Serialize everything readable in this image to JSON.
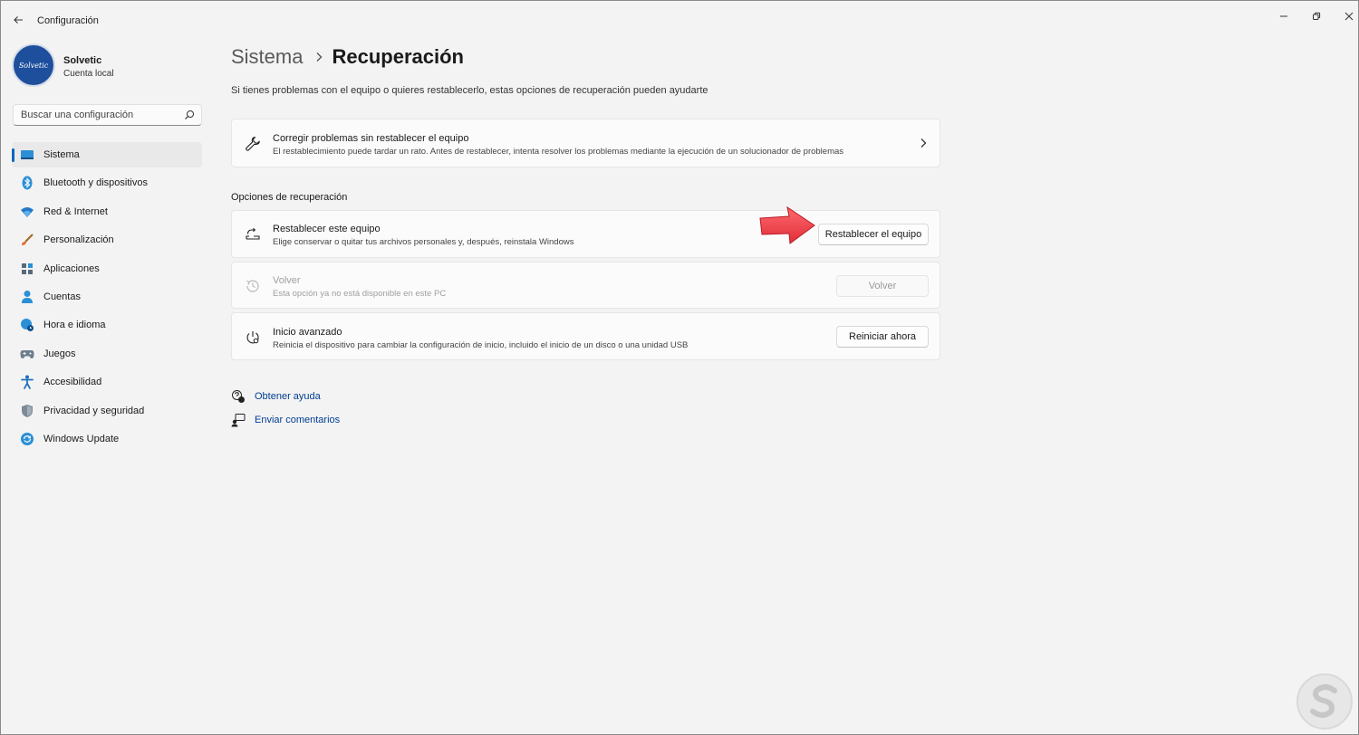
{
  "window": {
    "title": "Configuración",
    "controls": [
      "minimize-icon",
      "maximize-icon",
      "close-icon"
    ]
  },
  "profile": {
    "avatar_text": "Solvetic",
    "name": "Solvetic",
    "account_type": "Cuenta local"
  },
  "search": {
    "placeholder": "Buscar una configuración",
    "icon": "search-icon"
  },
  "sidebar": {
    "items": [
      {
        "label": "Sistema",
        "icon": "system-icon",
        "active": true
      },
      {
        "label": "Bluetooth y dispositivos",
        "icon": "bluetooth-icon"
      },
      {
        "label": "Red & Internet",
        "icon": "wifi-icon"
      },
      {
        "label": "Personalización",
        "icon": "brush-icon"
      },
      {
        "label": "Aplicaciones",
        "icon": "apps-icon"
      },
      {
        "label": "Cuentas",
        "icon": "person-icon"
      },
      {
        "label": "Hora e idioma",
        "icon": "globe-clock-icon"
      },
      {
        "label": "Juegos",
        "icon": "gamepad-icon"
      },
      {
        "label": "Accesibilidad",
        "icon": "accessibility-icon"
      },
      {
        "label": "Privacidad y seguridad",
        "icon": "shield-icon"
      },
      {
        "label": "Windows Update",
        "icon": "update-icon"
      }
    ]
  },
  "breadcrumb": {
    "parent": "Sistema",
    "current": "Recuperación"
  },
  "main": {
    "subtitle": "Si tienes problemas con el equipo o quieres restablecerlo, estas opciones de recuperación pueden ayudarte",
    "troubleshoot": {
      "title": "Corregir problemas sin restablecer el equipo",
      "description": "El restablecimiento puede tardar un rato. Antes de restablecer, intenta resolver los problemas mediante la ejecución de un solucionador de problemas",
      "icon": "wrench-icon"
    },
    "section_label": "Opciones de recuperación",
    "options": [
      {
        "title": "Restablecer este equipo",
        "description": "Elige conservar o quitar tus archivos personales y, después, reinstala Windows",
        "button": "Restablecer el equipo",
        "icon": "reset-pc-icon",
        "enabled": true
      },
      {
        "title": "Volver",
        "description": "Esta opción ya no está disponible en este PC",
        "button": "Volver",
        "icon": "history-icon",
        "enabled": false
      },
      {
        "title": "Inicio avanzado",
        "description": "Reinicia el dispositivo para cambiar la configuración de inicio, incluido el inicio de un disco o una unidad USB",
        "button": "Reiniciar ahora",
        "icon": "advanced-startup-icon",
        "enabled": true
      }
    ],
    "links": [
      {
        "label": "Obtener ayuda",
        "icon": "help-chat-icon"
      },
      {
        "label": "Enviar comentarios",
        "icon": "feedback-icon"
      }
    ]
  },
  "colors": {
    "accent": "#0067c0",
    "link": "#003e92",
    "background": "#f3f3f3",
    "card": "#fbfbfb",
    "annotation_arrow": "#f0424c"
  }
}
